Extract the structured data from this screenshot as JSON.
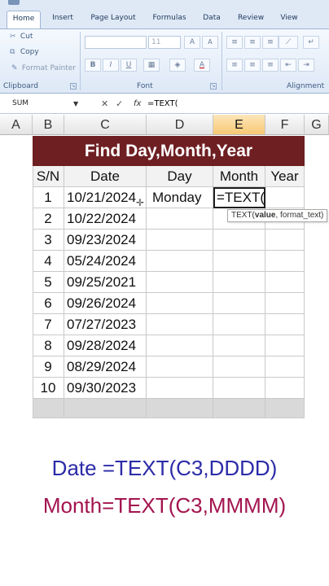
{
  "ribbon": {
    "tabs": [
      "Home",
      "Insert",
      "Page Layout",
      "Formulas",
      "Data",
      "Review",
      "View"
    ],
    "active_tab": "Home",
    "clipboard": {
      "cut": "Cut",
      "copy": "Copy",
      "format_painter": "Format Painter",
      "group_label": "Clipboard"
    },
    "font": {
      "font_size": "11",
      "bold": "B",
      "italic": "I",
      "underline": "U",
      "grow": "A",
      "shrink": "A",
      "font_color": "A",
      "group_label": "Font"
    },
    "alignment": {
      "group_label": "Alignment"
    }
  },
  "formula_bar": {
    "name_box": "SUM",
    "cancel": "✕",
    "enter": "✓",
    "fx": "fx",
    "formula": "=TEXT("
  },
  "columns": [
    "A",
    "B",
    "C",
    "D",
    "E",
    "F",
    "G"
  ],
  "selected_column": "E",
  "sheet": {
    "title": "Find Day,Month,Year",
    "headers": [
      "S/N",
      "Date",
      "Day",
      "Month",
      "Year"
    ],
    "rows": [
      {
        "sn": "1",
        "date": "10/21/2024",
        "day": "Monday",
        "month": "=TEXT(",
        "year": ""
      },
      {
        "sn": "2",
        "date": "10/22/2024",
        "day": "",
        "month": "",
        "year": ""
      },
      {
        "sn": "3",
        "date": "09/23/2024",
        "day": "",
        "month": "",
        "year": ""
      },
      {
        "sn": "4",
        "date": "05/24/2024",
        "day": "",
        "month": "",
        "year": ""
      },
      {
        "sn": "5",
        "date": "09/25/2021",
        "day": "",
        "month": "",
        "year": ""
      },
      {
        "sn": "6",
        "date": "09/26/2024",
        "day": "",
        "month": "",
        "year": ""
      },
      {
        "sn": "7",
        "date": "07/27/2023",
        "day": "",
        "month": "",
        "year": ""
      },
      {
        "sn": "8",
        "date": "09/28/2024",
        "day": "",
        "month": "",
        "year": ""
      },
      {
        "sn": "9",
        "date": "08/29/2024",
        "day": "",
        "month": "",
        "year": ""
      },
      {
        "sn": "10",
        "date": "09/30/2023",
        "day": "",
        "month": "",
        "year": ""
      }
    ],
    "tooltip": {
      "func": "TEXT(",
      "arg1": "value",
      "rest": ", format_text)"
    }
  },
  "captions": {
    "line1": "Date =TEXT(C3,DDDD)",
    "line2": "Month=TEXT(C3,MMMM)",
    "line1_color": "#2b2ba8",
    "line2_color": "#a3144f"
  },
  "colors": {
    "title_bg": "#6e1f22",
    "selected_col_header": "#f7c874"
  }
}
